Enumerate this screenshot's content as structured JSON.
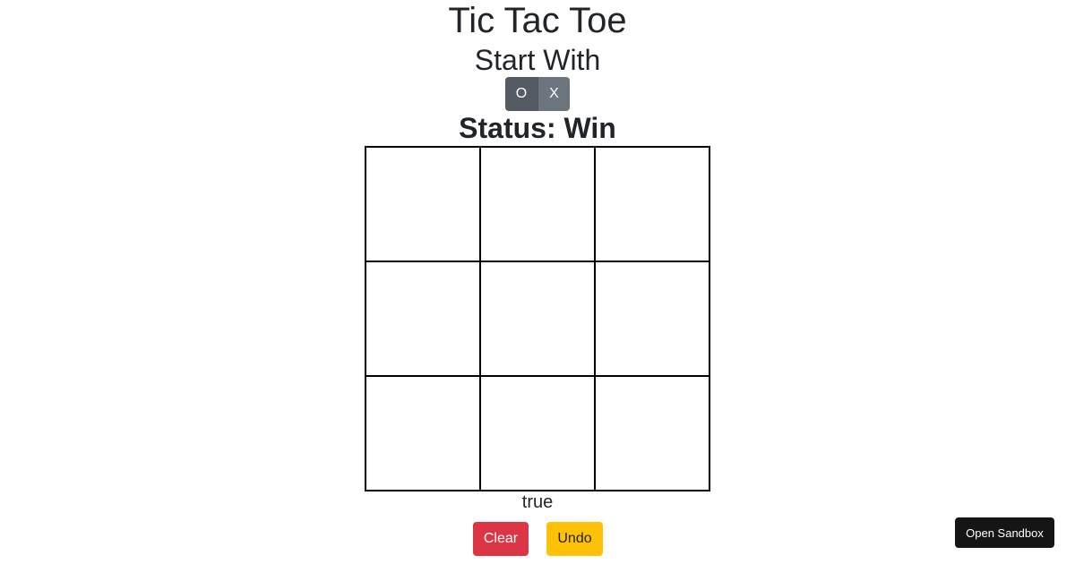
{
  "header": {
    "title": "Tic Tac Toe",
    "start_with_label": "Start With"
  },
  "start_options": [
    {
      "label": "O",
      "selected": true
    },
    {
      "label": "X",
      "selected": false
    }
  ],
  "status": {
    "text": "Status: Win"
  },
  "board": {
    "cells": [
      "",
      "",
      "",
      "",
      "",
      "",
      "",
      "",
      ""
    ]
  },
  "flag_text": "true",
  "actions": {
    "clear_label": "Clear",
    "undo_label": "Undo"
  },
  "sandbox": {
    "label": "Open Sandbox"
  },
  "colors": {
    "clear": "#dc3545",
    "undo": "#ffc107",
    "toggle_active": "#545b62",
    "toggle_inactive": "#6c757d"
  }
}
